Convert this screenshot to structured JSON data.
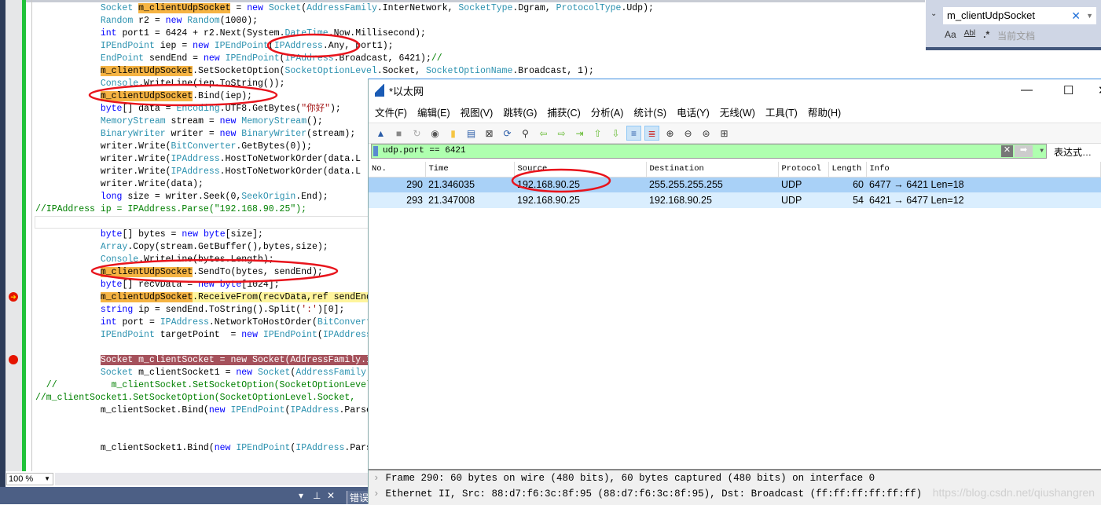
{
  "editor": {
    "lines": [
      [
        [
          "",
          "            "
        ],
        [
          "ty",
          "Socket"
        ],
        [
          "",
          " "
        ],
        [
          "hl",
          "m_clientUdpSocket"
        ],
        [
          "",
          " = "
        ],
        [
          "kw",
          "new"
        ],
        [
          "",
          " "
        ],
        [
          "ty",
          "Socket"
        ],
        [
          "",
          "("
        ],
        [
          "ty",
          "AddressFamily"
        ],
        [
          "",
          ".InterNetwork, "
        ],
        [
          "ty",
          "SocketType"
        ],
        [
          "",
          ".Dgram, "
        ],
        [
          "ty",
          "ProtocolType"
        ],
        [
          "",
          ".Udp);"
        ]
      ],
      [
        [
          "",
          "            "
        ],
        [
          "ty",
          "Random"
        ],
        [
          "",
          " r2 = "
        ],
        [
          "kw",
          "new"
        ],
        [
          "",
          " "
        ],
        [
          "ty",
          "Random"
        ],
        [
          "",
          "(1000);"
        ]
      ],
      [
        [
          "",
          "            "
        ],
        [
          "kw",
          "int"
        ],
        [
          "",
          " port1 = 6424 + r2.Next(System."
        ],
        [
          "ty",
          "DateTime"
        ],
        [
          "",
          ".Now.Millisecond);"
        ]
      ],
      [
        [
          "",
          "            "
        ],
        [
          "ty",
          "IPEndPoint"
        ],
        [
          "",
          " iep = "
        ],
        [
          "kw",
          "new"
        ],
        [
          "",
          " "
        ],
        [
          "ty",
          "IPEndPoint"
        ],
        [
          "",
          "("
        ],
        [
          "ty",
          "IPAddress"
        ],
        [
          "",
          ".Any, port1);"
        ]
      ],
      [
        [
          "",
          "            "
        ],
        [
          "ty",
          "EndPoint"
        ],
        [
          "",
          " sendEnd = "
        ],
        [
          "kw",
          "new"
        ],
        [
          "",
          " "
        ],
        [
          "ty",
          "IPEndPoint"
        ],
        [
          "",
          "("
        ],
        [
          "ty",
          "IPAddress"
        ],
        [
          "",
          ".Broadcast, 6421);"
        ],
        [
          "cm",
          "//"
        ]
      ],
      [
        [
          "",
          "            "
        ],
        [
          "hl",
          "m_clientUdpSocket"
        ],
        [
          "",
          ".SetSocketOption("
        ],
        [
          "ty",
          "SocketOptionLevel"
        ],
        [
          "",
          ".Socket, "
        ],
        [
          "ty",
          "SocketOptionName"
        ],
        [
          "",
          ".Broadcast, 1);"
        ]
      ],
      [
        [
          "",
          "            "
        ],
        [
          "ty",
          "Console"
        ],
        [
          "",
          ".WriteLine(iep.ToString());"
        ]
      ],
      [
        [
          "",
          "            "
        ],
        [
          "hl",
          "m_clientUdpSocket"
        ],
        [
          "",
          ".Bind(iep);"
        ]
      ],
      [
        [
          "",
          "            "
        ],
        [
          "kw",
          "byte"
        ],
        [
          "",
          "[] data = "
        ],
        [
          "ty",
          "Encoding"
        ],
        [
          "",
          ".UTF8.GetBytes("
        ],
        [
          "st",
          "\"你好\""
        ],
        [
          "",
          ");"
        ]
      ],
      [
        [
          "",
          "            "
        ],
        [
          "ty",
          "MemoryStream"
        ],
        [
          "",
          " stream = "
        ],
        [
          "kw",
          "new"
        ],
        [
          "",
          " "
        ],
        [
          "ty",
          "MemoryStream"
        ],
        [
          "",
          "();"
        ]
      ],
      [
        [
          "",
          "            "
        ],
        [
          "ty",
          "BinaryWriter"
        ],
        [
          "",
          " writer = "
        ],
        [
          "kw",
          "new"
        ],
        [
          "",
          " "
        ],
        [
          "ty",
          "BinaryWriter"
        ],
        [
          "",
          "(stream);"
        ]
      ],
      [
        [
          "",
          "            writer.Write("
        ],
        [
          "ty",
          "BitConverter"
        ],
        [
          "",
          ".GetBytes(0));"
        ]
      ],
      [
        [
          "",
          "            writer.Write("
        ],
        [
          "ty",
          "IPAddress"
        ],
        [
          "",
          ".HostToNetworkOrder(data.L"
        ]
      ],
      [
        [
          "",
          "            writer.Write("
        ],
        [
          "ty",
          "IPAddress"
        ],
        [
          "",
          ".HostToNetworkOrder(data.L"
        ]
      ],
      [
        [
          "",
          "            writer.Write(data);"
        ]
      ],
      [
        [
          "",
          "            "
        ],
        [
          "kw",
          "long"
        ],
        [
          "",
          " size = writer.Seek(0,"
        ],
        [
          "ty",
          "SeekOrigin"
        ],
        [
          "",
          ".End);"
        ]
      ],
      [
        [
          "cm",
          "//IPAddress ip = IPAddress.Parse(\"192.168.90.25\");"
        ]
      ],
      [
        [
          "",
          ""
        ]
      ],
      [
        [
          "",
          "            "
        ],
        [
          "kw",
          "byte"
        ],
        [
          "",
          "[] bytes = "
        ],
        [
          "kw",
          "new"
        ],
        [
          "",
          " "
        ],
        [
          "kw",
          "byte"
        ],
        [
          "",
          "[size];"
        ]
      ],
      [
        [
          "",
          "            "
        ],
        [
          "ty",
          "Array"
        ],
        [
          "",
          ".Copy(stream.GetBuffer(),bytes,size);"
        ]
      ],
      [
        [
          "",
          "            "
        ],
        [
          "ty",
          "Console"
        ],
        [
          "",
          ".WriteLine(bytes.Length);"
        ]
      ],
      [
        [
          "",
          "            "
        ],
        [
          "hl",
          "m_clientUdpSocket"
        ],
        [
          "",
          ".SendTo(bytes, sendEnd);"
        ]
      ],
      [
        [
          "",
          "            "
        ],
        [
          "kw",
          "byte"
        ],
        [
          "",
          "[] recvData = "
        ],
        [
          "kw",
          "new"
        ],
        [
          "",
          " "
        ],
        [
          "kw",
          "byte"
        ],
        [
          "",
          "[1024];"
        ]
      ],
      [
        [
          "",
          "            "
        ],
        [
          "hl",
          "m_clientUdpSocket"
        ],
        [
          "cur",
          ".ReceiveFrom(recvData,ref sendEnd);                    "
        ]
      ],
      [
        [
          "",
          "            "
        ],
        [
          "kw",
          "string"
        ],
        [
          "",
          " ip = sendEnd.ToString().Split("
        ],
        [
          "st",
          "':'"
        ],
        [
          "",
          ")[0];"
        ]
      ],
      [
        [
          "",
          "            "
        ],
        [
          "kw",
          "int"
        ],
        [
          "",
          " port = "
        ],
        [
          "ty",
          "IPAddress"
        ],
        [
          "",
          ".NetworkToHostOrder("
        ],
        [
          "ty",
          "BitConverter"
        ]
      ],
      [
        [
          "",
          "            "
        ],
        [
          "ty",
          "IPEndPoint"
        ],
        [
          "",
          " targetPoint  = "
        ],
        [
          "kw",
          "new"
        ],
        [
          "",
          " "
        ],
        [
          "ty",
          "IPEndPoint"
        ],
        [
          "",
          "("
        ],
        [
          "ty",
          "IPAddress"
        ]
      ],
      [
        [
          "",
          ""
        ]
      ],
      [
        [
          "",
          "            "
        ],
        [
          "bp",
          "Socket m_clientSocket = new Socket(AddressFamily.InterNetwork"
        ]
      ],
      [
        [
          "",
          "            "
        ],
        [
          "ty",
          "Socket"
        ],
        [
          "",
          " m_clientSocket1 = "
        ],
        [
          "kw",
          "new"
        ],
        [
          "",
          " "
        ],
        [
          "ty",
          "Socket"
        ],
        [
          "",
          "("
        ],
        [
          "ty",
          "AddressFamily"
        ]
      ],
      [
        [
          "cm",
          "  //          m_clientSocket.SetSocketOption(SocketOptionLevel"
        ]
      ],
      [
        [
          "cm",
          "//m_clientSocket1.SetSocketOption(SocketOptionLevel.Socket,"
        ]
      ],
      [
        [
          "",
          "            m_clientSocket.Bind("
        ],
        [
          "kw",
          "new"
        ],
        [
          "",
          " "
        ],
        [
          "ty",
          "IPEndPoint"
        ],
        [
          "",
          "("
        ],
        [
          "ty",
          "IPAddress"
        ],
        [
          "",
          ".Parse"
        ]
      ],
      [
        [
          "",
          ""
        ]
      ],
      [
        [
          "",
          ""
        ]
      ],
      [
        [
          "",
          "            m_clientSocket1.Bind("
        ],
        [
          "kw",
          "new"
        ],
        [
          "",
          " "
        ],
        [
          "ty",
          "IPEndPoint"
        ],
        [
          "",
          "("
        ],
        [
          "ty",
          "IPAddress"
        ],
        [
          "",
          ".Parse"
        ]
      ]
    ],
    "zoom": "100 %",
    "error_tab": "错误"
  },
  "find": {
    "value": "m_clientUdpSocket",
    "opt_case": "Aa",
    "opt_word": "Abl",
    "opt_regex": ".*",
    "scope": "当前文档"
  },
  "wireshark": {
    "title": "*以太网",
    "menu": [
      "文件(F)",
      "编辑(E)",
      "视图(V)",
      "跳转(G)",
      "捕获(C)",
      "分析(A)",
      "统计(S)",
      "电话(Y)",
      "无线(W)",
      "工具(T)",
      "帮助(H)"
    ],
    "filter": "udp.port == 6421",
    "expression_label": "表达式…",
    "columns": [
      "No.",
      "Time",
      "Source",
      "Destination",
      "Protocol",
      "Length",
      "Info"
    ],
    "packets": [
      [
        "290",
        "21.346035",
        "192.168.90.25",
        "255.255.255.255",
        "UDP",
        "60",
        "6477 → 6421  Len=18"
      ],
      [
        "293",
        "21.347008",
        "192.168.90.25",
        "192.168.90.25",
        "UDP",
        "54",
        "6421 → 6477  Len=12"
      ]
    ],
    "details": [
      "Frame 290: 60 bytes on wire (480 bits), 60 bytes captured (480 bits) on interface 0",
      "Ethernet II, Src: 88:d7:f6:3c:8f:95 (88:d7:f6:3c:8f:95), Dst: Broadcast (ff:ff:ff:ff:ff:ff)"
    ],
    "watermark": "https://blog.csdn.net/qiushangren"
  },
  "colors": {
    "annotation": "#e8141c",
    "highlight": "#f6b443",
    "selected_row": "#a9d1f7",
    "filter_ok": "#afffaf"
  }
}
